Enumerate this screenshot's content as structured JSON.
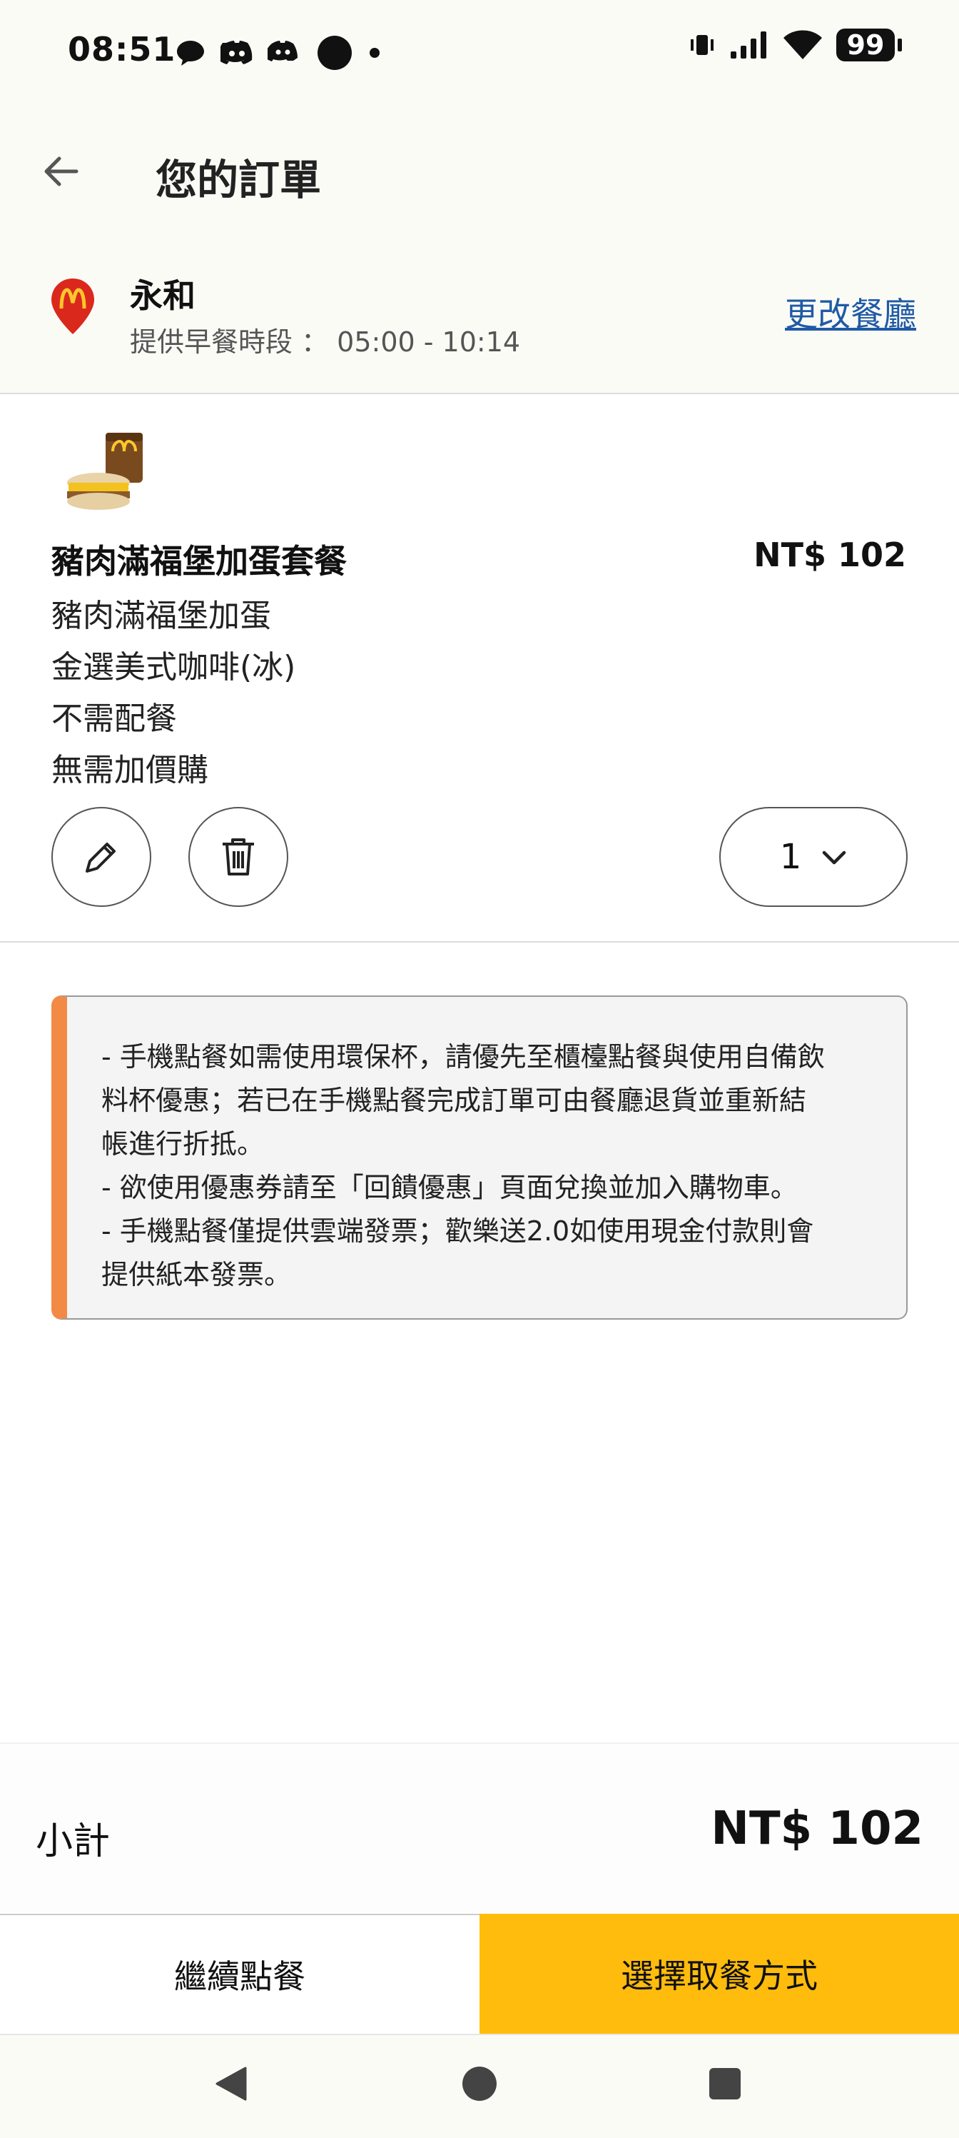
{
  "status_bar": {
    "time": "08:51",
    "battery": "99",
    "left_icons": [
      "speech-bubble-icon",
      "discord-icon",
      "discord-alt-icon",
      "circle-icon",
      "dot-icon"
    ],
    "right_icons": [
      "vibrate-icon",
      "signal-icon",
      "wifi-icon",
      "battery-icon"
    ]
  },
  "header": {
    "title": "您的訂單",
    "back_icon": "arrow-left-icon"
  },
  "restaurant": {
    "name": "永和",
    "hours": "提供早餐時段 ： 05:00 - 10:14",
    "change_label": "更改餐廳",
    "brand_color": "#DA291C"
  },
  "item": {
    "name": "豬肉滿福堡加蛋套餐",
    "price": "NT$ 102",
    "options": [
      "豬肉滿福堡加蛋",
      "金選美式咖啡(冰)",
      "不需配餐",
      "無需加價購"
    ],
    "quantity": "1"
  },
  "notice": {
    "lines": [
      "- 手機點餐如需使用環保杯，請優先至櫃檯點餐與使用自備飲",
      "料杯優惠；若已在手機點餐完成訂單可由餐廳退貨並重新結",
      "帳進行折抵。",
      "- 欲使用優惠券請至「回饋優惠」頁面兌換並加入購物車。",
      "- 手機點餐僅提供雲端發票；歡樂送2.0如使用現金付款則會",
      "提供紙本發票。"
    ],
    "accent_color": "#F28A45"
  },
  "footer": {
    "subtotal_label": "小計",
    "subtotal_value": "NT$ 102",
    "continue_label": "繼續點餐",
    "checkout_label": "選擇取餐方式",
    "checkout_color": "#FFBC0D"
  }
}
